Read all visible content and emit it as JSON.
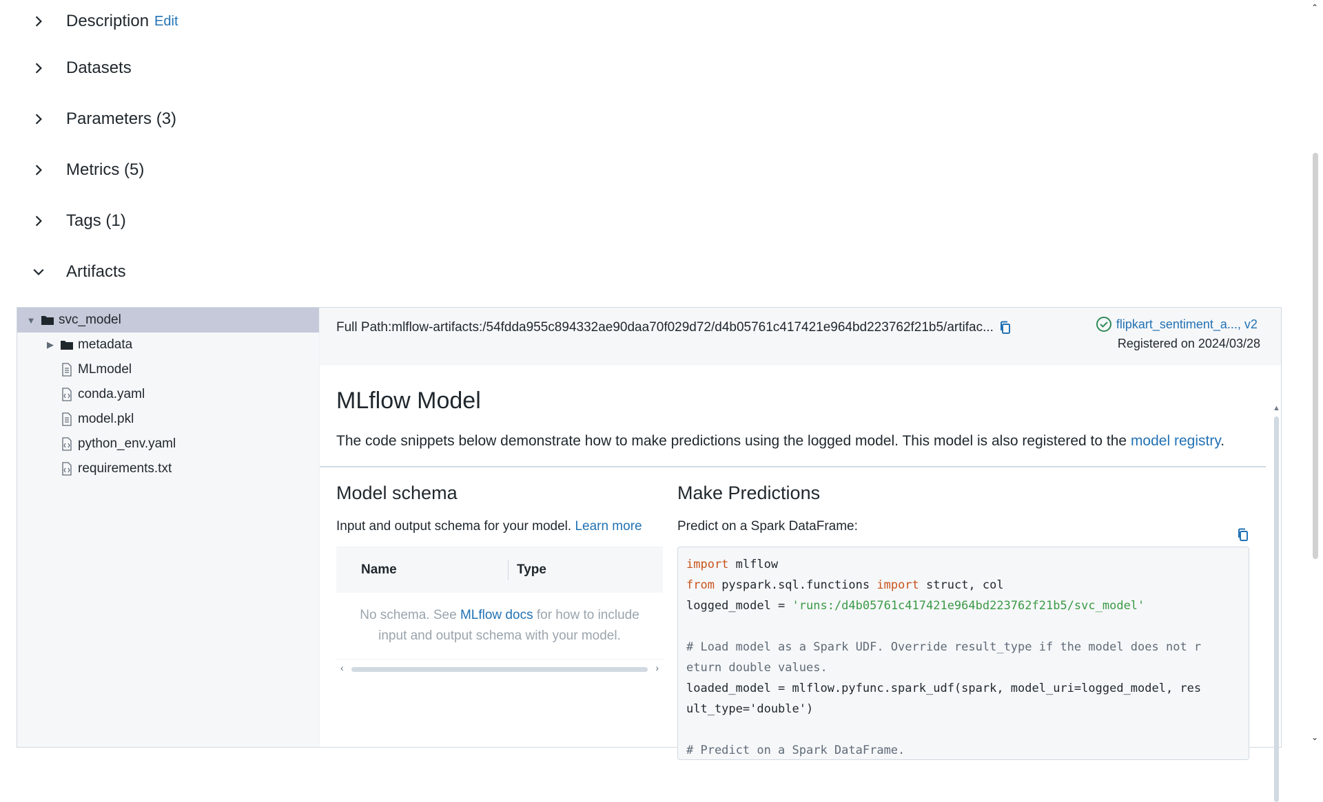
{
  "sections": [
    {
      "title": "Description",
      "edit": "Edit",
      "expanded": false
    },
    {
      "title": "Datasets",
      "expanded": false
    },
    {
      "title": "Parameters (3)",
      "expanded": false
    },
    {
      "title": "Metrics (5)",
      "expanded": false
    },
    {
      "title": "Tags (1)",
      "expanded": false
    },
    {
      "title": "Artifacts",
      "expanded": true
    }
  ],
  "tree": {
    "root": "svc_model",
    "items": [
      {
        "label": "metadata",
        "type": "folder"
      },
      {
        "label": "MLmodel",
        "type": "file"
      },
      {
        "label": "conda.yaml",
        "type": "code-file"
      },
      {
        "label": "model.pkl",
        "type": "file"
      },
      {
        "label": "python_env.yaml",
        "type": "code-file"
      },
      {
        "label": "requirements.txt",
        "type": "code-file"
      }
    ]
  },
  "viewer": {
    "full_path": "Full Path:mlflow-artifacts:/54fdda955c894332ae90daa70f029d72/d4b05761c417421e964bd223762f21b5/artifac...",
    "registered_model_link": "flipkart_sentiment_a..., v2",
    "registered_on": "Registered on 2024/03/28",
    "title": "MLflow Model",
    "description_prefix": "The code snippets below demonstrate how to make predictions using the logged model. This model is also registered to the ",
    "description_link": "model registry",
    "description_suffix": "."
  },
  "schema": {
    "title": "Model schema",
    "subtitle": "Input and output schema for your model. ",
    "learn_more": "Learn more",
    "col_name": "Name",
    "col_type": "Type",
    "empty_prefix": "No schema. See ",
    "empty_link": "MLflow docs",
    "empty_suffix": " for how to include input and output schema with your model."
  },
  "predict": {
    "title": "Make Predictions",
    "subtitle": "Predict on a Spark DataFrame:",
    "code": {
      "l1_kw": "import",
      "l1_rest": " mlflow",
      "l2_kw1": "from",
      "l2_mid": " pyspark.sql.functions ",
      "l2_kw2": "import",
      "l2_rest": " struct, col",
      "l3_pre": "logged_model = ",
      "l3_str": "'runs:/d4b05761c417421e964bd223762f21b5/svc_model'",
      "l5_cm": "# Load model as a Spark UDF. Override result_type if the model does not r",
      "l6_cm": "eturn double values.",
      "l7": "loaded_model = mlflow.pyfunc.spark_udf(spark, model_uri=logged_model, res",
      "l8": "ult_type='double')",
      "l10_cm": "# Predict on a Spark DataFrame."
    }
  },
  "colors": {
    "accent": "#2272b4",
    "keyword": "#c8531b",
    "string": "#3a9a45",
    "success": "#2e8b57"
  }
}
